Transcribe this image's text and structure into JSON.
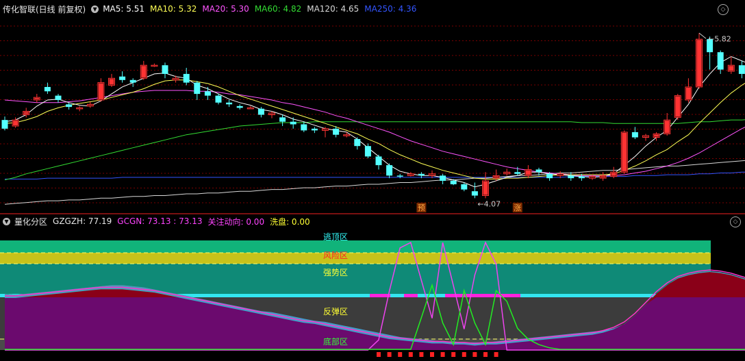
{
  "colors": {
    "up": "#ff3333",
    "down": "#54ffff",
    "ma5": "#ffffff",
    "ma10": "#ffff55",
    "ma20": "#ff55ff",
    "ma60": "#33dd33",
    "ma120": "#d8d8d8",
    "ma250": "#3355ff",
    "grid": "#7a0000"
  },
  "top": {
    "title": "传化智联(日线 前复权)",
    "indicators": [
      {
        "label": "MA5: 5.51",
        "color": "#ffffff"
      },
      {
        "label": "MA10: 5.32",
        "color": "#ffff55"
      },
      {
        "label": "MA20: 5.30",
        "color": "#ff55ff"
      },
      {
        "label": "MA60: 4.82",
        "color": "#33dd33"
      },
      {
        "label": "MA120: 4.65",
        "color": "#d8d8d8"
      },
      {
        "label": "MA250: 4.36",
        "color": "#3355ff"
      }
    ],
    "high_label": "5.82",
    "low_label": "4.07",
    "badge_yu": "预",
    "badge_zhang": "涨",
    "candles": [
      [
        4.82,
        4.72,
        4.86,
        4.7
      ],
      [
        4.75,
        4.82,
        4.85,
        4.73
      ],
      [
        4.88,
        4.92,
        4.96,
        4.85
      ],
      [
        5.05,
        5.08,
        5.12,
        5.02
      ],
      [
        5.2,
        5.15,
        5.25,
        5.12
      ],
      [
        5.1,
        5.05,
        5.12,
        5.02
      ],
      [
        5.0,
        4.97,
        5.02,
        4.94
      ],
      [
        4.95,
        4.96,
        4.98,
        4.92
      ],
      [
        4.98,
        5.0,
        5.03,
        4.96
      ],
      [
        5.05,
        5.25,
        5.3,
        5.03
      ],
      [
        5.22,
        5.3,
        5.35,
        5.2
      ],
      [
        5.32,
        5.28,
        5.38,
        5.25
      ],
      [
        5.28,
        5.25,
        5.3,
        5.2
      ],
      [
        5.3,
        5.45,
        5.5,
        5.28
      ],
      [
        5.45,
        5.45,
        5.47,
        5.43
      ],
      [
        5.45,
        5.35,
        5.48,
        5.3
      ],
      [
        5.28,
        5.3,
        5.33,
        5.25
      ],
      [
        5.35,
        5.25,
        5.42,
        5.22
      ],
      [
        5.25,
        5.12,
        5.27,
        5.05
      ],
      [
        5.15,
        5.1,
        5.2,
        5.05
      ],
      [
        5.1,
        5.02,
        5.12,
        5.0
      ],
      [
        5.02,
        5.0,
        5.05,
        4.97
      ],
      [
        4.98,
        4.96,
        5.0,
        4.94
      ],
      [
        4.96,
        4.96,
        4.98,
        4.95
      ],
      [
        4.95,
        4.88,
        4.97,
        4.85
      ],
      [
        4.88,
        4.9,
        4.92,
        4.84
      ],
      [
        4.85,
        4.8,
        4.88,
        4.75
      ],
      [
        4.8,
        4.77,
        4.85,
        4.72
      ],
      [
        4.77,
        4.7,
        4.8,
        4.68
      ],
      [
        4.72,
        4.7,
        4.74,
        4.67
      ],
      [
        4.7,
        4.72,
        4.74,
        4.62
      ],
      [
        4.72,
        4.65,
        4.75,
        4.62
      ],
      [
        4.65,
        4.65,
        4.68,
        4.62
      ],
      [
        4.6,
        4.52,
        4.62,
        4.48
      ],
      [
        4.52,
        4.4,
        4.55,
        4.38
      ],
      [
        4.4,
        4.3,
        4.42,
        4.25
      ],
      [
        4.3,
        4.18,
        4.32,
        4.15
      ],
      [
        4.18,
        4.17,
        4.2,
        4.15
      ],
      [
        4.18,
        4.2,
        4.22,
        4.17
      ],
      [
        4.2,
        4.18,
        4.22,
        4.15
      ],
      [
        4.18,
        4.2,
        4.24,
        4.15
      ],
      [
        4.18,
        4.12,
        4.2,
        4.08
      ],
      [
        4.12,
        4.08,
        4.14,
        4.07
      ],
      [
        4.08,
        4.02,
        4.1,
        4.0
      ],
      [
        4.0,
        3.95,
        4.1,
        3.92
      ],
      [
        3.95,
        4.12,
        4.22,
        3.92
      ],
      [
        4.15,
        4.18,
        4.25,
        4.12
      ],
      [
        4.2,
        4.22,
        4.26,
        4.18
      ],
      [
        4.22,
        4.2,
        4.28,
        4.18
      ],
      [
        4.18,
        4.25,
        4.3,
        4.15
      ],
      [
        4.25,
        4.22,
        4.27,
        4.18
      ],
      [
        4.2,
        4.15,
        4.22,
        4.12
      ],
      [
        4.18,
        4.2,
        4.23,
        4.15
      ],
      [
        4.18,
        4.15,
        4.22,
        4.12
      ],
      [
        4.17,
        4.15,
        4.2,
        4.12
      ],
      [
        4.15,
        4.17,
        4.19,
        4.13
      ],
      [
        4.15,
        4.18,
        4.22,
        4.12
      ],
      [
        4.17,
        4.22,
        4.28,
        4.15
      ],
      [
        4.22,
        4.68,
        4.7,
        4.2
      ],
      [
        4.68,
        4.62,
        4.74,
        4.6
      ],
      [
        4.62,
        4.64,
        4.66,
        4.58
      ],
      [
        4.62,
        4.66,
        4.68,
        4.58
      ],
      [
        4.66,
        4.82,
        4.9,
        4.64
      ],
      [
        4.85,
        5.1,
        5.12,
        4.82
      ],
      [
        5.05,
        5.2,
        5.3,
        5.02
      ],
      [
        5.2,
        5.75,
        5.82,
        5.18
      ],
      [
        5.75,
        5.6,
        5.78,
        5.4
      ],
      [
        5.6,
        5.4,
        5.62,
        5.35
      ],
      [
        5.38,
        5.45,
        5.55,
        5.35
      ],
      [
        5.45,
        5.35,
        5.5,
        5.3
      ],
      [
        5.42,
        5.45,
        5.48,
        5.4
      ],
      [
        5.45,
        5.4,
        5.48,
        5.38
      ],
      [
        5.4,
        5.28,
        5.42,
        5.25
      ],
      [
        5.22,
        5.18,
        5.25,
        5.15
      ],
      [
        5.18,
        5.16,
        5.2,
        5.12
      ],
      [
        5.15,
        5.2,
        5.23,
        5.13
      ],
      [
        5.22,
        5.1,
        5.24,
        5.08
      ],
      [
        5.05,
        5.08,
        5.12,
        5.02
      ],
      [
        5.06,
        5.12,
        5.18,
        5.04
      ],
      [
        5.12,
        5.15,
        5.25,
        5.1
      ],
      [
        5.16,
        5.12,
        5.18,
        5.08
      ],
      [
        5.15,
        5.2,
        5.4,
        5.12
      ],
      [
        5.22,
        5.55,
        5.75,
        5.18
      ],
      [
        5.4,
        5.52,
        5.6,
        5.38
      ],
      [
        5.45,
        5.62,
        5.7,
        5.42
      ],
      [
        5.62,
        5.58,
        5.7,
        5.5
      ],
      [
        5.62,
        5.45,
        5.65,
        5.4
      ]
    ],
    "series": {
      "ma5": [
        4.8,
        4.82,
        4.88,
        4.98,
        5.05,
        5.06,
        5.02,
        4.99,
        4.98,
        5.04,
        5.12,
        5.2,
        5.25,
        5.3,
        5.35,
        5.36,
        5.32,
        5.3,
        5.22,
        5.18,
        5.12,
        5.06,
        5.02,
        4.99,
        4.94,
        4.92,
        4.88,
        4.83,
        4.8,
        4.76,
        4.72,
        4.7,
        4.68,
        4.6,
        4.5,
        4.4,
        4.3,
        4.23,
        4.2,
        4.18,
        4.18,
        4.16,
        4.13,
        4.1,
        4.05,
        4.08,
        4.12,
        4.16,
        4.18,
        4.22,
        4.22,
        4.2,
        4.19,
        4.18,
        4.17,
        4.16,
        4.17,
        4.2,
        4.3,
        4.4,
        4.52,
        4.62,
        4.7,
        4.85,
        5.0,
        5.2,
        5.35,
        5.48,
        5.55,
        5.5,
        5.45,
        5.42,
        5.38,
        5.32,
        5.26,
        5.22,
        5.18,
        5.14,
        5.12,
        5.13,
        5.13,
        5.17,
        5.28,
        5.38,
        5.48,
        5.52,
        5.55
      ],
      "ma10": [
        4.78,
        4.79,
        4.82,
        4.86,
        4.92,
        4.96,
        4.99,
        5.01,
        5.03,
        5.05,
        5.08,
        5.11,
        5.14,
        5.18,
        5.23,
        5.27,
        5.28,
        5.28,
        5.26,
        5.24,
        5.2,
        5.15,
        5.1,
        5.06,
        5.02,
        4.98,
        4.94,
        4.9,
        4.86,
        4.82,
        4.78,
        4.74,
        4.7,
        4.66,
        4.6,
        4.55,
        4.48,
        4.42,
        4.37,
        4.32,
        4.28,
        4.24,
        4.21,
        4.18,
        4.15,
        4.14,
        4.14,
        4.15,
        4.15,
        4.16,
        4.17,
        4.18,
        4.19,
        4.19,
        4.19,
        4.19,
        4.19,
        4.2,
        4.24,
        4.29,
        4.35,
        4.42,
        4.48,
        4.57,
        4.65,
        4.78,
        4.9,
        5.02,
        5.13,
        5.22,
        5.3,
        5.36,
        5.4,
        5.4,
        5.38,
        5.35,
        5.3,
        5.26,
        5.22,
        5.18,
        5.16,
        5.15,
        5.18,
        5.22,
        5.28,
        5.35,
        5.4
      ],
      "ma20": [
        5.05,
        5.04,
        5.03,
        5.02,
        5.02,
        5.02,
        5.03,
        5.04,
        5.06,
        5.08,
        5.1,
        5.12,
        5.14,
        5.15,
        5.16,
        5.16,
        5.16,
        5.16,
        5.15,
        5.15,
        5.14,
        5.12,
        5.11,
        5.09,
        5.07,
        5.05,
        5.02,
        5.0,
        4.97,
        4.94,
        4.91,
        4.87,
        4.84,
        4.8,
        4.76,
        4.72,
        4.68,
        4.63,
        4.58,
        4.54,
        4.5,
        4.46,
        4.43,
        4.4,
        4.37,
        4.34,
        4.31,
        4.28,
        4.26,
        4.24,
        4.22,
        4.21,
        4.2,
        4.19,
        4.18,
        4.18,
        4.18,
        4.18,
        4.19,
        4.21,
        4.23,
        4.26,
        4.29,
        4.33,
        4.38,
        4.44,
        4.51,
        4.58,
        4.65,
        4.72,
        4.78,
        4.84,
        4.89,
        4.94,
        4.98,
        5.02,
        5.05,
        5.08,
        5.1,
        5.12,
        5.14,
        5.16,
        5.19,
        5.22,
        5.26,
        5.3,
        5.34
      ],
      "ma60": [
        4.13,
        4.16,
        4.2,
        4.23,
        4.26,
        4.29,
        4.32,
        4.35,
        4.38,
        4.41,
        4.44,
        4.47,
        4.5,
        4.53,
        4.56,
        4.59,
        4.62,
        4.65,
        4.67,
        4.69,
        4.71,
        4.73,
        4.75,
        4.76,
        4.77,
        4.78,
        4.79,
        4.79,
        4.79,
        4.8,
        4.8,
        4.8,
        4.8,
        4.8,
        4.8,
        4.8,
        4.8,
        4.8,
        4.8,
        4.8,
        4.8,
        4.8,
        4.8,
        4.8,
        4.8,
        4.8,
        4.8,
        4.8,
        4.8,
        4.8,
        4.8,
        4.8,
        4.8,
        4.8,
        4.79,
        4.79,
        4.79,
        4.78,
        4.78,
        4.78,
        4.78,
        4.78,
        4.78,
        4.78,
        4.79,
        4.8,
        4.8,
        4.81,
        4.82,
        4.82,
        4.83,
        4.84,
        4.84,
        4.85,
        4.86,
        4.86,
        4.87,
        4.88,
        4.88,
        4.89,
        4.9,
        4.9,
        4.91,
        4.92,
        4.92,
        4.93,
        4.93
      ],
      "ma120": [
        3.85,
        3.86,
        3.87,
        3.88,
        3.89,
        3.89,
        3.9,
        3.9,
        3.91,
        3.92,
        3.92,
        3.93,
        3.94,
        3.94,
        3.95,
        3.95,
        3.96,
        3.97,
        3.97,
        3.98,
        3.98,
        3.99,
        4.0,
        4.0,
        4.01,
        4.02,
        4.02,
        4.03,
        4.04,
        4.04,
        4.05,
        4.06,
        4.06,
        4.07,
        4.08,
        4.08,
        4.09,
        4.1,
        4.1,
        4.11,
        4.12,
        4.13,
        4.13,
        4.14,
        4.15,
        4.15,
        4.16,
        4.17,
        4.18,
        4.18,
        4.19,
        4.2,
        4.21,
        4.21,
        4.22,
        4.23,
        4.24,
        4.24,
        4.25,
        4.26,
        4.27,
        4.28,
        4.29,
        4.29,
        4.3,
        4.31,
        4.32,
        4.33,
        4.34,
        4.35,
        4.36,
        4.37,
        4.38,
        4.39,
        4.4,
        4.41,
        4.42,
        4.43,
        4.44,
        4.45,
        4.46,
        4.47,
        4.48,
        4.49,
        4.5,
        4.51,
        4.52
      ],
      "ma250": [
        4.14,
        4.14,
        4.14,
        4.14,
        4.15,
        4.15,
        4.15,
        4.15,
        4.15,
        4.15,
        4.15,
        4.16,
        4.16,
        4.16,
        4.16,
        4.16,
        4.16,
        4.16,
        4.16,
        4.16,
        4.16,
        4.16,
        4.16,
        4.16,
        4.16,
        4.16,
        4.16,
        4.16,
        4.16,
        4.16,
        4.16,
        4.16,
        4.16,
        4.16,
        4.16,
        4.16,
        4.16,
        4.16,
        4.16,
        4.16,
        4.16,
        4.16,
        4.16,
        4.16,
        4.16,
        4.16,
        4.16,
        4.16,
        4.16,
        4.16,
        4.16,
        4.16,
        4.16,
        4.17,
        4.17,
        4.17,
        4.17,
        4.17,
        4.17,
        4.18,
        4.18,
        4.18,
        4.19,
        4.19,
        4.19,
        4.2,
        4.2,
        4.21,
        4.21,
        4.22,
        4.22,
        4.23,
        4.23,
        4.24,
        4.24,
        4.25,
        4.25,
        4.26,
        4.26,
        4.27,
        4.27,
        4.28,
        4.28,
        4.29,
        4.29,
        4.3,
        4.31
      ]
    }
  },
  "bottom": {
    "title": "量化分区",
    "indicators": [
      {
        "label": "GZGZH: 77.19",
        "color": "#e8e8e8"
      },
      {
        "label": "GCGN: 73.13 : 73.13",
        "color": "#ff44ff"
      },
      {
        "label": "关注动向: 0.00",
        "color": "#ff44ff"
      },
      {
        "label": "洗盘: 0.00",
        "color": "#ffff33"
      }
    ],
    "zones": [
      {
        "label": "逃顶区",
        "color": "#33ffff"
      },
      {
        "label": "风险区",
        "color": "#ff2222"
      },
      {
        "label": "强势区",
        "color": "#ffff33"
      },
      {
        "label": "反弹区",
        "color": "#ffff33"
      },
      {
        "label": "底部区",
        "color": "#33ff33"
      }
    ],
    "gzgzh": [
      52,
      51,
      52,
      53,
      54,
      55,
      56,
      57,
      58,
      59,
      60,
      60,
      59,
      58,
      56,
      54,
      52,
      50,
      48,
      46,
      44,
      42,
      40,
      38,
      36,
      35,
      33,
      31,
      29,
      27,
      26,
      24,
      22,
      20,
      18,
      16,
      14,
      12,
      11,
      10,
      9,
      8,
      8,
      7,
      7,
      7,
      8,
      9,
      10,
      11,
      12,
      13,
      14,
      15,
      16,
      17,
      18,
      20,
      24,
      32,
      42,
      52,
      60,
      67,
      70,
      72,
      73,
      72,
      70,
      67,
      64,
      60,
      56,
      53,
      52,
      51,
      52,
      56,
      62,
      66,
      70,
      72,
      74,
      76,
      77,
      77,
      77
    ],
    "gcgn": [
      50,
      50,
      51,
      52,
      53,
      54,
      55,
      56,
      57,
      58,
      58,
      58,
      57,
      56,
      55,
      53,
      51,
      49,
      47,
      45,
      43,
      41,
      39,
      37,
      35,
      33,
      31,
      29,
      27,
      26,
      24,
      22,
      20,
      18,
      16,
      14,
      12,
      11,
      10,
      9,
      8,
      8,
      7,
      7,
      6,
      7,
      7,
      8,
      9,
      10,
      11,
      12,
      13,
      14,
      15,
      16,
      18,
      21,
      26,
      34,
      44,
      54,
      62,
      68,
      71,
      73,
      74,
      73,
      71,
      68,
      65,
      62,
      58,
      55,
      53,
      52,
      52,
      55,
      60,
      64,
      67,
      69,
      70,
      71,
      72,
      73,
      73
    ],
    "magenta_peaks": [
      0,
      0,
      0,
      0,
      0,
      0,
      0,
      0,
      0,
      0,
      0,
      0,
      0,
      0,
      0,
      0,
      0,
      0,
      0,
      0,
      0,
      0,
      0,
      0,
      0,
      0,
      0,
      0,
      0,
      0,
      0,
      0,
      0,
      0,
      0,
      10,
      55,
      95,
      100,
      65,
      30,
      100,
      60,
      20,
      70,
      100,
      80,
      0,
      0,
      0,
      0,
      0,
      0,
      0,
      0,
      0,
      0,
      0,
      0,
      0,
      0,
      0,
      0,
      0,
      0,
      0,
      0,
      0,
      0,
      0,
      0,
      0,
      0,
      0,
      0,
      0,
      0,
      0,
      0,
      0,
      0,
      0,
      0,
      0,
      0,
      0,
      0
    ],
    "green_peaks": [
      0,
      0,
      0,
      0,
      0,
      0,
      0,
      0,
      0,
      0,
      0,
      0,
      0,
      0,
      0,
      0,
      0,
      0,
      0,
      0,
      0,
      0,
      0,
      0,
      0,
      0,
      0,
      0,
      0,
      0,
      0,
      0,
      0,
      0,
      0,
      0,
      0,
      0,
      0,
      30,
      60,
      25,
      5,
      55,
      25,
      5,
      55,
      45,
      20,
      10,
      5,
      2,
      0,
      0,
      0,
      0,
      0,
      0,
      0,
      0,
      0,
      0,
      0,
      0,
      0,
      0,
      0,
      0,
      0,
      0,
      0,
      0,
      0,
      0,
      0,
      0,
      0,
      0,
      0,
      0,
      0,
      0,
      0,
      0,
      0,
      0,
      0
    ],
    "bottom_markers": [
      35,
      36,
      37,
      38,
      39,
      40,
      41,
      42,
      43,
      44,
      45,
      46
    ],
    "top_markers": [
      71,
      72,
      73,
      74,
      75
    ]
  }
}
